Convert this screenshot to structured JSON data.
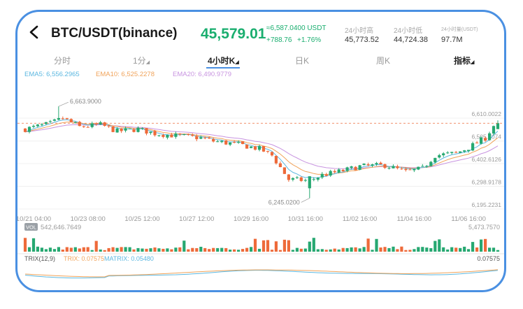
{
  "header": {
    "pair": "BTC/USDT(binance)",
    "price": "45,579.01",
    "usdt_price": "≈6,587.0400 USDT",
    "change": "+788.76",
    "change_pct": "+1.76%",
    "high_label": "24小时高",
    "high_value": "45,773.52",
    "low_label": "24小时低",
    "low_value": "44,724.38",
    "vol_label": "24小时量(USDT)",
    "vol_value": "97.7M"
  },
  "tabs": [
    {
      "label": "分时"
    },
    {
      "label": "1分"
    },
    {
      "label": "4小时K"
    },
    {
      "label": "日K"
    },
    {
      "label": "周K"
    },
    {
      "label": "指标"
    }
  ],
  "ema": {
    "ema5": "EMA5: 6,556.2965",
    "ema10": "EMA10: 6,525.2278",
    "ema20": "EMA20: 6,490.9779"
  },
  "colors": {
    "up": "#26a871",
    "down": "#ee6a3a",
    "ema5": "#5bb7e0",
    "ema10": "#f0a35a",
    "ema20": "#c894e0",
    "trix": "#f0a35a",
    "matrix": "#5bb7e0",
    "accent": "#4a90e2",
    "price_green": "#1aae6f"
  },
  "chart_data": {
    "type": "candlestick",
    "ylim": [
      6195.2231,
      6725
    ],
    "y_ticks": [
      "6,610.0022",
      "6,505.7074",
      "6,402.6126",
      "6,298.9178",
      "6,195.2231"
    ],
    "y_tick_values": [
      6610.0022,
      6505.7074,
      6402.6126,
      6298.9178,
      6195.2231
    ],
    "x_ticks": [
      "10/21 04:00",
      "10/23 08:00",
      "10/25 12:00",
      "10/27 12:00",
      "10/29 16:00",
      "10/31 16:00",
      "11/02 16:00",
      "11/04 16:00",
      "11/06 16:00"
    ],
    "x_tick_index": [
      2,
      15,
      28,
      41,
      54,
      67,
      80,
      93,
      106
    ],
    "max_label": "6,663.9000",
    "max_index": 8,
    "min_label": "6,245.0200",
    "min_index": 68,
    "last_price": 6587.04,
    "anchors": [
      [
        0,
        6560
      ],
      [
        6,
        6585
      ],
      [
        9,
        6610
      ],
      [
        13,
        6570
      ],
      [
        18,
        6580
      ],
      [
        22,
        6550
      ],
      [
        27,
        6560
      ],
      [
        31,
        6540
      ],
      [
        36,
        6530
      ],
      [
        42,
        6520
      ],
      [
        45,
        6505
      ],
      [
        51,
        6490
      ],
      [
        56,
        6470
      ],
      [
        59,
        6440
      ],
      [
        63,
        6330
      ],
      [
        68,
        6325
      ],
      [
        71,
        6350
      ],
      [
        76,
        6370
      ],
      [
        80,
        6390
      ],
      [
        86,
        6395
      ],
      [
        91,
        6365
      ],
      [
        95,
        6380
      ],
      [
        98,
        6440
      ],
      [
        103,
        6450
      ],
      [
        106,
        6475
      ],
      [
        110,
        6520
      ],
      [
        112,
        6575
      ]
    ],
    "volume": {
      "label": "VOL",
      "value": "542,646.7649",
      "max_label": "5,473.7570",
      "ylim": [
        0,
        5473.757
      ],
      "hi_index": [
        0,
        2,
        17,
        38,
        55,
        57,
        58,
        60,
        62,
        63,
        68,
        69,
        82,
        84,
        98,
        99,
        107,
        109,
        110
      ]
    },
    "trix": {
      "label": "TRIX(12,9)",
      "trix_label": "TRIX: 0.07575",
      "matrix_label": "MATRIX: 0.05480",
      "right_label": "0.07575"
    }
  }
}
